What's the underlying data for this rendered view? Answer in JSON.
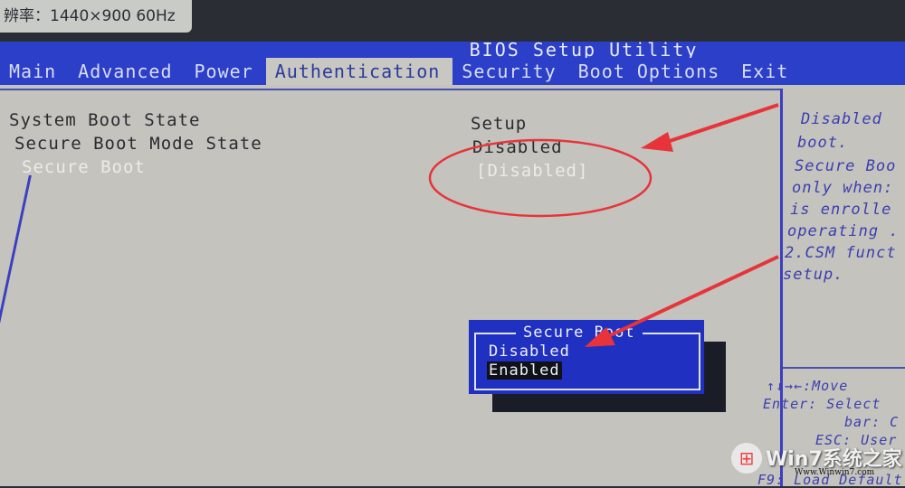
{
  "osd": {
    "text": "辨率：1440×900 60Hz"
  },
  "bios": {
    "title": "BIOS Setup Utility",
    "tabs": [
      {
        "label": "Main",
        "active": false
      },
      {
        "label": "Advanced",
        "active": false
      },
      {
        "label": "Power",
        "active": false
      },
      {
        "label": "Authentication",
        "active": true
      },
      {
        "label": "Security",
        "active": false
      },
      {
        "label": "Boot Options",
        "active": false
      },
      {
        "label": "Exit",
        "active": false
      }
    ],
    "items": [
      {
        "label": "System Boot State",
        "value": "Setup"
      },
      {
        "label": "Secure Boot Mode State",
        "value": "Disabled"
      },
      {
        "label": "Secure Boot",
        "value": "[Disabled]",
        "selected": true
      }
    ],
    "help": {
      "lines": [
        "Disabled",
        "boot.",
        "Secure Boo",
        "only when:",
        "is enrolle",
        "operating .",
        "2.CSM funct",
        "setup."
      ],
      "keys": [
        "↑↓→←:Move",
        "Enter: Select",
        "bar: C",
        "ESC: User D",
        "F9: Load Default"
      ]
    },
    "popup": {
      "title": "Secure Boot",
      "options": [
        {
          "label": "Disabled",
          "highlighted": false
        },
        {
          "label": "Enabled",
          "highlighted": true
        }
      ]
    }
  },
  "annotations": {
    "color": "#e8333a"
  },
  "watermark": {
    "text": "Win7系统之家",
    "url": "Www.Winwin7.com"
  }
}
